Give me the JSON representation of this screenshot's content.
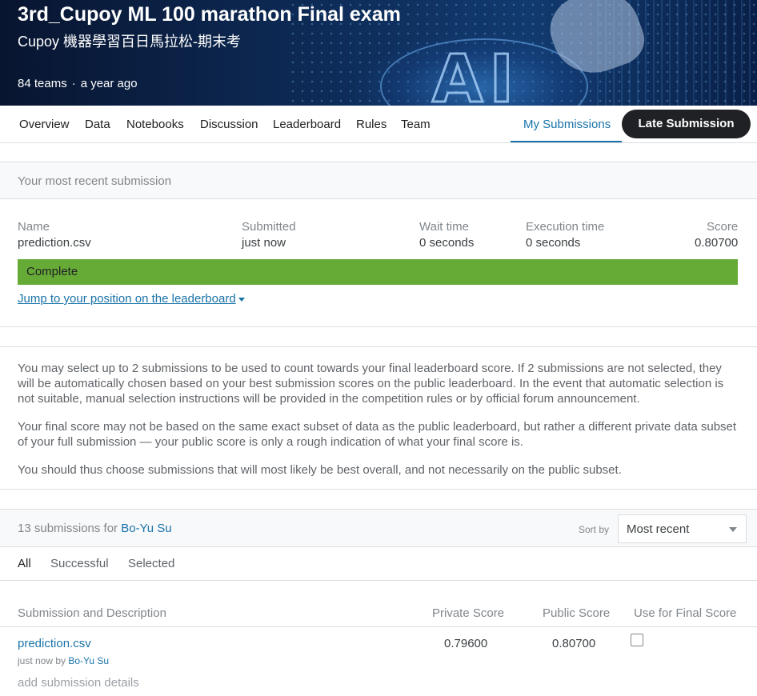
{
  "competition": {
    "title": "3rd_Cupoy ML 100 marathon Final exam",
    "subtitle": "Cupoy 機器學習百日馬拉松-期末考",
    "teams": "84 teams",
    "separator": "·",
    "age": "a year ago",
    "banner_text": "AI"
  },
  "nav": {
    "tabs": [
      "Overview",
      "Data",
      "Notebooks",
      "Discussion",
      "Leaderboard",
      "Rules",
      "Team"
    ],
    "my_submissions": "My Submissions",
    "late_submission": "Late Submission"
  },
  "recent": {
    "heading": "Your most recent submission",
    "labels": {
      "name": "Name",
      "submitted": "Submitted",
      "wait": "Wait time",
      "execution": "Execution time",
      "score": "Score"
    },
    "values": {
      "name": "prediction.csv",
      "submitted": "just now",
      "wait": "0 seconds",
      "execution": "0 seconds",
      "score": "0.80700"
    },
    "status": "Complete",
    "status_color": "#67ab37",
    "jump_link": "Jump to your position on the leaderboard"
  },
  "info": {
    "p1": "You may select up to 2 submissions to be used to count towards your final leaderboard score. If 2 submissions are not selected, they will be automatically chosen based on your best submission scores on the public leaderboard. In the event that automatic selection is not suitable, manual selection instructions will be provided in the competition rules or by official forum announcement.",
    "p2": "Your final score may not be based on the same exact subset of data as the public leaderboard, but rather a different private data subset of your full submission — your public score is only a rough indication of what your final score is.",
    "p3": "You should thus choose submissions that will most likely be best overall, and not necessarily on the public subset."
  },
  "submissions": {
    "count_text": "13 submissions for",
    "user": "Bo-Yu Su",
    "sort_label": "Sort by",
    "sort_value": "Most recent",
    "filters": [
      "All",
      "Successful",
      "Selected"
    ],
    "headers": {
      "desc": "Submission and Description",
      "private": "Private Score",
      "public": "Public Score",
      "final": "Use for Final Score"
    },
    "rows": [
      {
        "file": "prediction.csv",
        "time": "just now by",
        "user": "Bo-Yu Su",
        "private": "0.79600",
        "public": "0.80700",
        "details": "add submission details"
      }
    ]
  },
  "accent_color": "#1a73a8"
}
